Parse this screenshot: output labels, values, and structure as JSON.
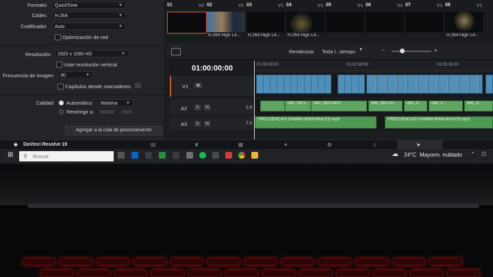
{
  "render_panel": {
    "format_label": "Formato",
    "format_value": "QuickTime",
    "codec_label": "Códec",
    "codec_value": "H.264",
    "encoder_label": "Codificador",
    "encoder_value": "Auto",
    "network_opt_label": "Optimización de red",
    "resolution_label": "Resolución",
    "resolution_value": "1920 x 1080 HD",
    "vertical_res_label": "Usar resolución vertical",
    "framerate_label": "Frecuencia de imagen",
    "framerate_value": "30",
    "chapters_label": "Capítulos desde marcadores",
    "quality_label": "Calidad",
    "quality_auto_label": "Automático",
    "quality_value": "Máxima",
    "restrict_label": "Restringir a",
    "restrict_value": "80000",
    "restrict_unit": "Kb/s",
    "add_queue_button": "Agregar a la cola de procesamiento"
  },
  "clips": [
    {
      "num": "01",
      "track": "V2",
      "name": ""
    },
    {
      "num": "02",
      "track": "V1",
      "name": "H.264 High L4..."
    },
    {
      "num": "03",
      "track": "V1",
      "name": "H.264 High L4..."
    },
    {
      "num": "04",
      "track": "V1",
      "name": "H.264 High L4..."
    },
    {
      "num": "05",
      "track": "V1",
      "name": ""
    },
    {
      "num": "06",
      "track": "V2",
      "name": ""
    },
    {
      "num": "07",
      "track": "V1",
      "name": ""
    },
    {
      "num": "08",
      "track": "V1",
      "name": "H.264 High L4..."
    }
  ],
  "toolbar": {
    "render_label": "Renderizar",
    "range_value": "Toda l...tiempo"
  },
  "timeline": {
    "timecode": "01:00:00:00",
    "ruler": [
      "01:00:00:00",
      "01:02:38:00",
      "01:05:16:00"
    ],
    "tracks": {
      "v1": "V1",
      "a2": "A2",
      "a3": "A3",
      "a2_level": "2.0",
      "a3_level": "7.0"
    },
    "audio_clips_a2": [
      "IMG_3921...",
      "IMG_3921.MOV",
      "IMG_3921.M...",
      "IMG_3...",
      "IMG_3...",
      "IMG_3..."
    ],
    "audio_clips_a3": [
      "FRECUENCIAS GAMMA BINAURALES.mp3",
      "FRECUENCIAS GAMMA BINAURALES.mp3"
    ]
  },
  "app": {
    "name": "DaVinci Resolve 19"
  },
  "taskbar": {
    "search_placeholder": "Buscar",
    "weather_temp": "24°C",
    "weather_desc": "Mayorm. nublado"
  },
  "colors": {
    "accent_video": "#4f8fb8",
    "accent_audio": "#5fa463",
    "keyboard_glow": "#d11111"
  }
}
